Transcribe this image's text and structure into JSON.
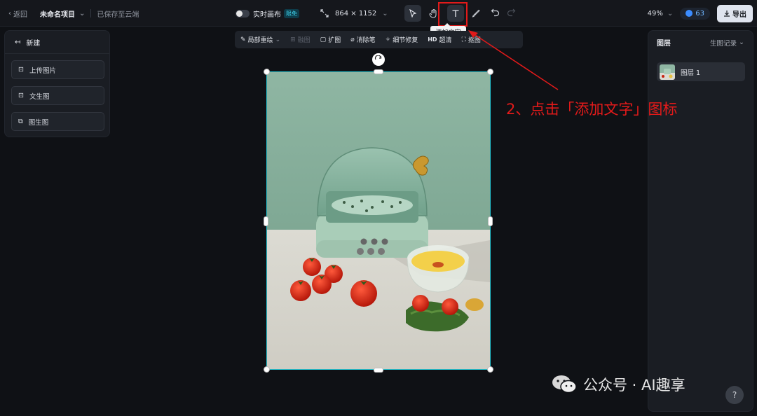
{
  "topbar": {
    "back_label": "返回",
    "project_name": "未命名项目",
    "save_status": "已保存至云端",
    "realtime_canvas_label": "实时画布",
    "free_badge": "限免",
    "canvas_size": "864 × 1152",
    "zoom_level": "49%",
    "credits": "63",
    "export_label": "导出"
  },
  "tools": {
    "select_icon": "cursor-arrow",
    "hand_icon": "hand",
    "text_icon": "text-T",
    "brush_icon": "brush",
    "undo_icon": "undo",
    "redo_icon": "redo"
  },
  "tooltip": {
    "text": "添加文字"
  },
  "sub_toolbar": {
    "items": [
      {
        "label": "局部重绘",
        "enabled": true
      },
      {
        "label": "融图",
        "enabled": false
      },
      {
        "label": "扩图",
        "enabled": true
      },
      {
        "label": "消除笔",
        "enabled": true
      },
      {
        "label": "细节修复",
        "enabled": true
      },
      {
        "label": "超清",
        "enabled": true
      },
      {
        "label": "抠图",
        "enabled": true
      }
    ]
  },
  "left_panel": {
    "title": "新建",
    "buttons": [
      {
        "label": "上传图片"
      },
      {
        "label": "文生图"
      },
      {
        "label": "图生图"
      }
    ]
  },
  "right_panel": {
    "title": "图层",
    "history_label": "生图记录",
    "layers": [
      {
        "name": "图层 1"
      }
    ]
  },
  "annotation": {
    "text": "2、点击「添加文字」图标",
    "color": "#e21a1a"
  },
  "watermark": {
    "text": "公众号 · AI趣享"
  },
  "help": {
    "label": "?"
  },
  "colors": {
    "background": "#0f1115",
    "accent_cyan": "#26c4d0",
    "annotation_red": "#e21a1a"
  }
}
